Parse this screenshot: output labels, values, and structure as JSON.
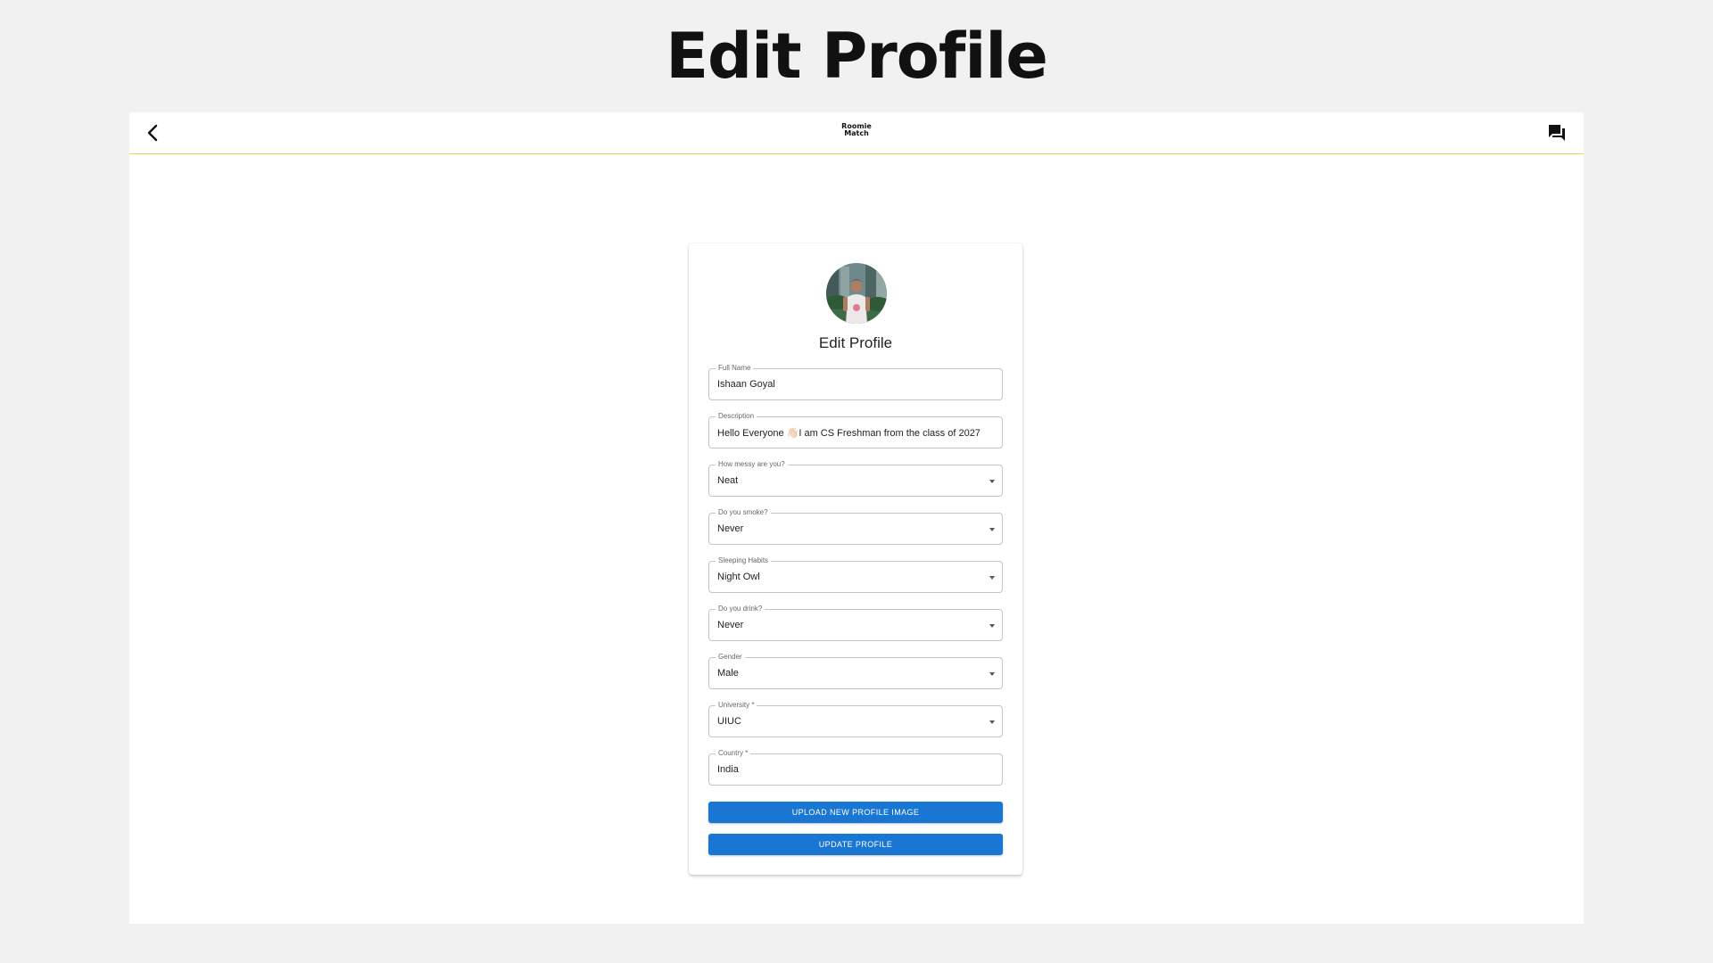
{
  "slide": {
    "title": "Edit Profile"
  },
  "header": {
    "logo_line1": "Roomie",
    "logo_line2": "Match",
    "back_icon": "chevron-left-icon",
    "chat_icon": "forum-icon",
    "accent_color": "#f2c94c"
  },
  "card": {
    "title": "Edit Profile",
    "fields": [
      {
        "label": "Full Name",
        "value": "Ishaan Goyal",
        "type": "text"
      },
      {
        "label": "Description",
        "value": "Hello Everyone 👋🏻I am CS Freshman from the class of 2027",
        "type": "text"
      },
      {
        "label": "How messy are you?",
        "value": "Neat",
        "type": "select"
      },
      {
        "label": "Do you smoke?",
        "value": "Never",
        "type": "select"
      },
      {
        "label": "Sleeping Habits",
        "value": "Night Owl",
        "type": "select"
      },
      {
        "label": "Do you drink?",
        "value": "Never",
        "type": "select"
      },
      {
        "label": "Gender",
        "value": "Male",
        "type": "select"
      },
      {
        "label": "University *",
        "value": "UIUC",
        "type": "select"
      },
      {
        "label": "Country *",
        "value": "India",
        "type": "text"
      }
    ],
    "upload_button": "UPLOAD NEW PROFILE IMAGE",
    "update_button": "UPDATE PROFILE",
    "button_color": "#1976d2"
  }
}
